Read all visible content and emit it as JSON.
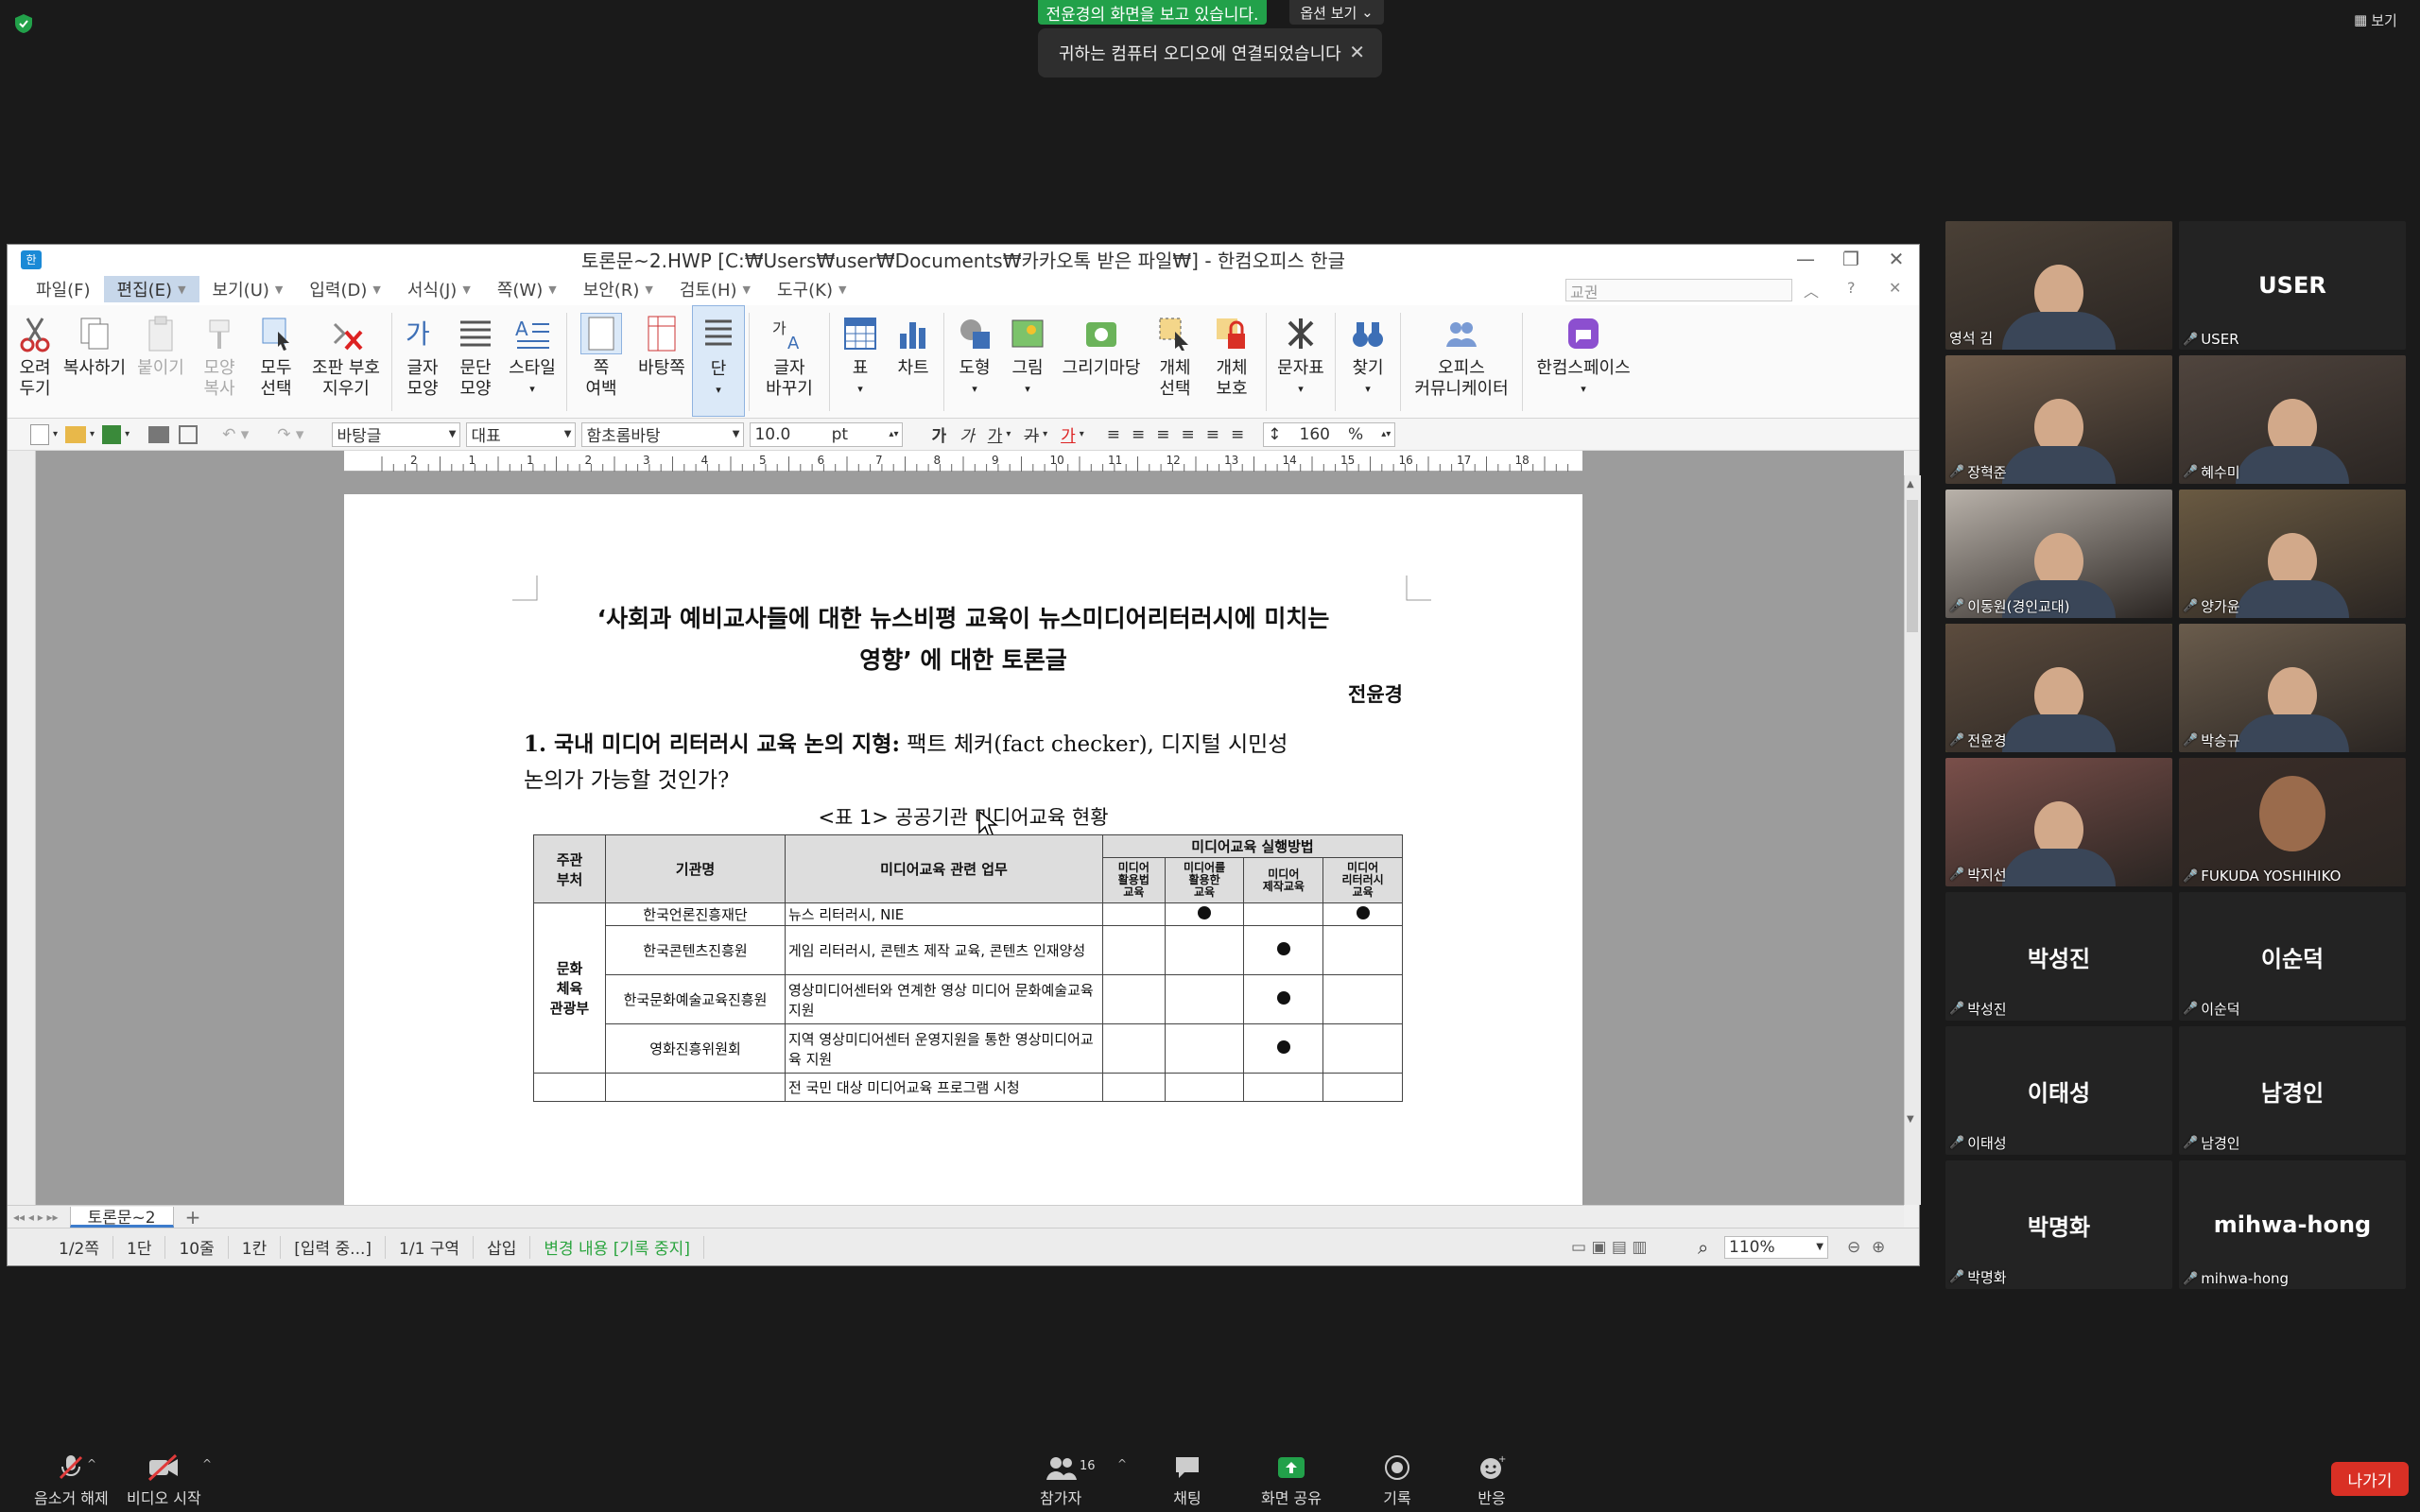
{
  "zoom": {
    "sharing_banner": "전윤경의 화면을 보고 있습니다.",
    "view_options": "옵션 보기",
    "audio_notice": "귀하는 컴퓨터 오디오에 연결되었습니다",
    "view_button": "보기",
    "toolbar": {
      "unmute": "음소거 해제",
      "start_video": "비디오 시작",
      "participants": "참가자",
      "participants_count": "16",
      "chat": "채팅",
      "share_screen": "화면 공유",
      "record": "기록",
      "reactions": "반응",
      "leave": "나가기"
    },
    "participants": [
      {
        "name": "영석 김",
        "video": true
      },
      {
        "name": "USER",
        "video": false
      },
      {
        "name": "장혁준",
        "video": true
      },
      {
        "name": "혜수미",
        "video": true
      },
      {
        "name": "이동원(경인교대)",
        "video": true
      },
      {
        "name": "양가윤",
        "video": true
      },
      {
        "name": "전윤경",
        "video": true
      },
      {
        "name": "박승규",
        "video": true
      },
      {
        "name": "박지선",
        "video": true
      },
      {
        "name": "FUKUDA YOSHIHIKO",
        "video": true
      },
      {
        "name": "박성진",
        "video": false
      },
      {
        "name": "이순덕",
        "video": false
      },
      {
        "name": "이태성",
        "video": false
      },
      {
        "name": "남경인",
        "video": false
      },
      {
        "name": "박명화",
        "video": false
      },
      {
        "name": "mihwa-hong",
        "video": false
      }
    ]
  },
  "hwp": {
    "title": "토론문~2.HWP [C:₩Users₩user₩Documents₩카카오톡 받은 파일₩] - 한컴오피스 한글",
    "menu": [
      "파일(F)",
      "편집(E)",
      "보기(U)",
      "입력(D)",
      "서식(J)",
      "쪽(W)",
      "보안(R)",
      "검토(H)",
      "도구(K)"
    ],
    "menu_search": "교권",
    "ribbon": {
      "cut": "오려\n두기",
      "copy": "복사하기",
      "paste": "붙이기",
      "format_copy": "모양\n복사",
      "select_all": "모두\n선택",
      "erase_code": "조판 부호\n지우기",
      "char_shape": "글자\n모양",
      "para_shape": "문단\n모양",
      "style": "스타일",
      "page_margin": "쪽\n여백",
      "background": "바탕쪽",
      "column": "단",
      "char_replace": "글자\n바꾸기",
      "table": "표",
      "chart": "차트",
      "shape": "도형",
      "picture": "그림",
      "drawing": "그리기마당",
      "obj_select": "개체\n선택",
      "obj_protect": "개체\n보호",
      "symbols": "문자표",
      "find": "찾기",
      "office_comm": "오피스\n커뮤니케이터",
      "space": "한컴스페이스"
    },
    "format": {
      "font_lang": "바탕글",
      "style": "대표",
      "font": "함초롬바탕",
      "size": "10.0",
      "unit": "pt",
      "line_spacing": "160",
      "pct": "%"
    },
    "ruler_numbers": [
      "2",
      "1",
      "1",
      "2",
      "3",
      "4",
      "5",
      "6",
      "7",
      "8",
      "9",
      "10",
      "11",
      "12",
      "13",
      "14",
      "15",
      "16",
      "17",
      "18"
    ],
    "doc": {
      "title_line1": "‘사회과 예비교사들에 대한 뉴스비평 교육이 뉴스미디어리터러시에 미치는",
      "title_line2": "영향’ 에 대한 토론글",
      "author": "전윤경",
      "section1_bold": "1. 국내 미디어 리터러시 교육 논의 지형:",
      "section1_rest": " 팩트 체커(fact checker), 디지털 시민성",
      "section1_line2": "논의가 가능할 것인가?",
      "table_caption": "<표 1> 공공기관 미디어교육 현황",
      "table": {
        "h_dept": "주관\n부처",
        "h_org": "기관명",
        "h_task": "미디어교육 관련 업무",
        "h_methods": "미디어교육 실행방법",
        "h_m1": "미디어\n활용법\n교육",
        "h_m2": "미디어를\n활용한\n교육",
        "h_m3": "미디어\n제작교육",
        "h_m4": "미디어\n리터러시\n교육",
        "dept": "문화\n체육\n관광부",
        "rows": [
          {
            "org": "한국언론진흥재단",
            "task": "뉴스 리터러시, NIE",
            "marks": [
              false,
              true,
              false,
              true
            ]
          },
          {
            "org": "한국콘텐츠진흥원",
            "task": "게임 리터러시, 콘텐츠 제작 교육, 콘텐츠 인재양성",
            "marks": [
              false,
              false,
              true,
              false
            ]
          },
          {
            "org": "한국문화예술교육진흥원",
            "task": "영상미디어센터와 연계한 영상 미디어 문화예술교육 지원",
            "marks": [
              false,
              false,
              true,
              false
            ]
          },
          {
            "org": "영화진흥위원회",
            "task": "지역 영상미디어센터 운영지원을 통한 영상미디어교육 지원",
            "marks": [
              false,
              false,
              true,
              false
            ]
          },
          {
            "org": "",
            "task": "전 국민 대상 미디어교육 프로그램 시청",
            "marks": [
              false,
              false,
              false,
              false
            ]
          }
        ]
      }
    },
    "tab_name": "토론문~2",
    "status": {
      "page": "1/2쪽",
      "column": "1단",
      "line": "10줄",
      "col": "1칸",
      "input": "[입력 중...]",
      "section": "1/1 구역",
      "mode": "삽입",
      "track": "변경 내용 [기록 중지]",
      "zoom": "110%"
    }
  }
}
